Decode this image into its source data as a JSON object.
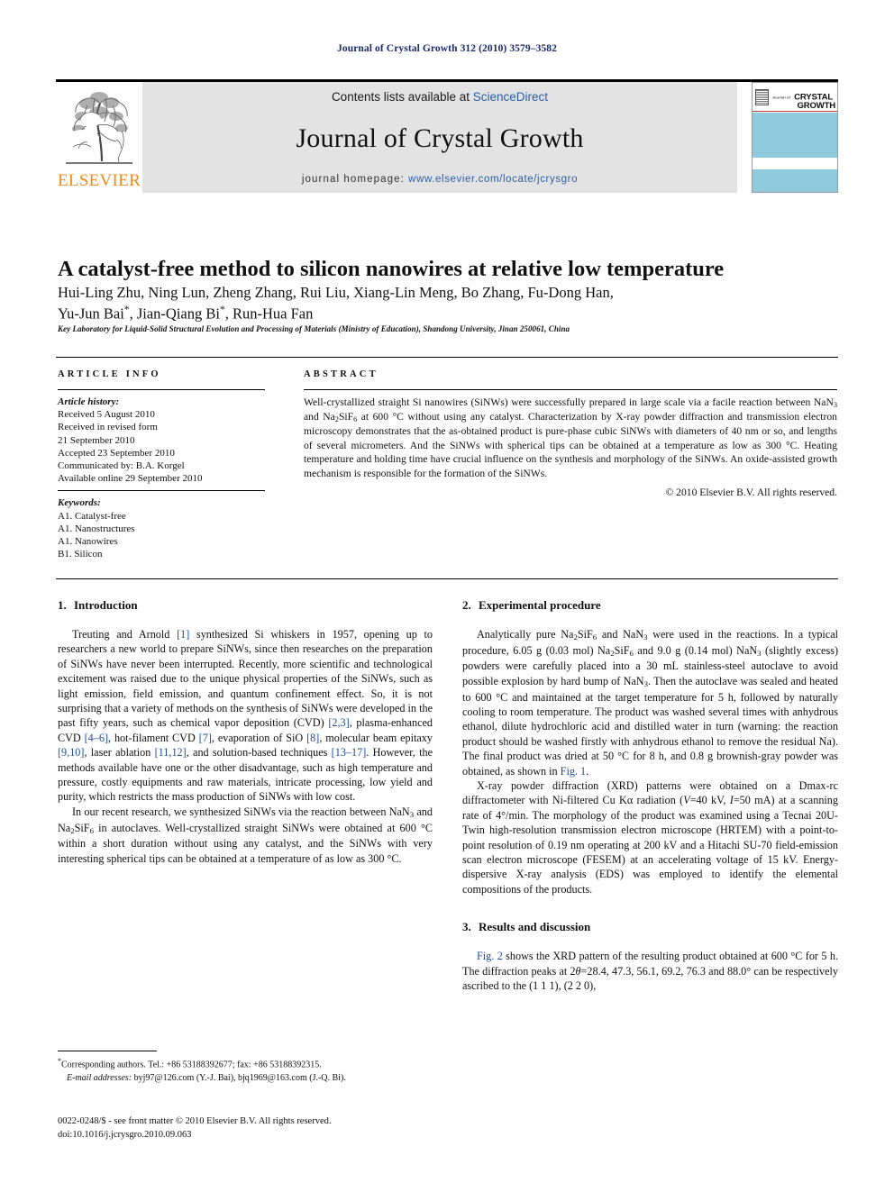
{
  "running_head": "Journal of Crystal Growth 312 (2010) 3579–3582",
  "masthead": {
    "publisher_name": "ELSEVIER",
    "contents_prefix": "Contents lists available at ",
    "contents_link": "ScienceDirect",
    "journal_title": "Journal of Crystal Growth",
    "homepage_label": "journal homepage:",
    "homepage_url": "www.elsevier.com/locate/jcrysgro",
    "cover": {
      "journal_of": "Journal of",
      "line1": "CRYSTAL",
      "line2": "GROWTH"
    },
    "colors": {
      "band_background": "#e3e3e3",
      "link": "#2b5fa8",
      "elsevier_orange": "#f08c1e",
      "cover_photo": "#8ecbdd",
      "cover_rule": "#c0392b"
    }
  },
  "article": {
    "title": "A catalyst-free method to silicon nanowires at relative low temperature",
    "authors_line1": "Hui-Ling Zhu, Ning Lun, Zheng Zhang, Rui Liu, Xiang-Lin Meng, Bo Zhang, Fu-Dong Han,",
    "authors_line2_a": "Yu-Jun Bai",
    "authors_line2_b": ", Jian-Qiang Bi",
    "authors_line2_c": ", Run-Hua Fan",
    "affiliation": "Key Laboratory for Liquid-Solid Structural Evolution and Processing of Materials (Ministry of Education), Shandong University, Jinan 250061, China"
  },
  "article_info": {
    "heading": "ARTICLE INFO",
    "history_label": "Article history:",
    "history": [
      "Received 5 August 2010",
      "Received in revised form",
      "21 September 2010",
      "Accepted 23 September 2010",
      "Communicated by: B.A. Korgel",
      "Available online 29 September 2010"
    ],
    "keywords_label": "Keywords:",
    "keywords": [
      "A1. Catalyst-free",
      "A1. Nanostructures",
      "A1. Nanowires",
      "B1. Silicon"
    ]
  },
  "abstract": {
    "heading": "ABSTRACT",
    "text_part1": "Well-crystallized straight Si nanowires (SiNWs) were successfully prepared in large scale via a facile reaction between NaN",
    "sub1": "3",
    "text_part2": " and Na",
    "sub2": "2",
    "text_part3": "SiF",
    "sub3": "6",
    "text_part4": " at 600 °C without using any catalyst. Characterization by X-ray powder diffraction and transmission electron microscopy demonstrates that the as-obtained product is pure-phase cubic SiNWs with diameters of 40 nm or so, and lengths of several micrometers. And the SiNWs with spherical tips can be obtained at a temperature as low as 300 °C. Heating temperature and holding time have crucial influence on the synthesis and morphology of the SiNWs. An oxide-assisted growth mechanism is responsible for the formation of the SiNWs.",
    "copyright": "© 2010 Elsevier B.V. All rights reserved."
  },
  "sections": {
    "introduction": {
      "number": "1.",
      "title": "Introduction",
      "p1_a": "Treuting and Arnold ",
      "p1_ref1": "[1]",
      "p1_b": " synthesized Si whiskers in 1957, opening up to researchers a new world to prepare SiNWs, since then researches on the preparation of SiNWs have never been interrupted. Recently, more scientific and technological excitement was raised due to the unique physical properties of the SiNWs, such as light emission, field emission, and quantum confinement effect. So, it is not surprising that a variety of methods on the synthesis of SiNWs were developed in the past fifty years, such as chemical vapor deposition (CVD) ",
      "p1_ref2": "[2,3]",
      "p1_c": ", plasma-enhanced CVD ",
      "p1_ref3": "[4–6]",
      "p1_d": ", hot-filament CVD ",
      "p1_ref4": "[7]",
      "p1_e": ", evaporation of SiO ",
      "p1_ref5": "[8]",
      "p1_f": ", molecular beam epitaxy ",
      "p1_ref6": "[9,10]",
      "p1_g": ", laser ablation ",
      "p1_ref7": "[11,12]",
      "p1_h": ", and solution-based techniques ",
      "p1_ref8": "[13–17]",
      "p1_i": ". However, the methods available have one or the other disadvantage, such as high temperature and pressure, costly equipments and raw materials, intricate processing, low yield and purity, which restricts the mass production of SiNWs with low cost.",
      "p2_a": "In our recent research, we synthesized SiNWs via the reaction between NaN",
      "p2_b": " and Na",
      "p2_c": "SiF",
      "p2_d": " in autoclaves. Well-crystallized straight SiNWs were obtained at 600 °C within a short duration without using any catalyst, and the SiNWs with very interesting spherical tips can be obtained at a temperature of as low as 300 °C."
    },
    "experimental": {
      "number": "2.",
      "title": "Experimental procedure",
      "p1_a": "Analytically pure Na",
      "p1_b": "SiF",
      "p1_c": " and NaN",
      "p1_d": " were used in the reactions. In a typical procedure, 6.05 g (0.03 mol) Na",
      "p1_e": "SiF",
      "p1_f": " and 9.0 g (0.14 mol) NaN",
      "p1_g": " (slightly excess) powders were carefully placed into a 30 mL stainless-steel autoclave to avoid possible explosion by hard bump of NaN",
      "p1_h": ". Then the autoclave was sealed and heated to 600 °C and maintained at the target temperature for 5 h, followed by naturally cooling to room temperature. The product was washed several times with anhydrous ethanol, dilute hydrochloric acid and distilled water in turn (warning: the reaction product should be washed firstly with anhydrous ethanol to remove the residual Na). The final product was dried at 50 °C for 8 h, and 0.8 g brownish-gray powder was obtained, as shown in ",
      "p1_figref": "Fig. 1",
      "p1_i": ".",
      "p2_a": "X-ray powder diffraction (XRD) patterns were obtained on a Dmax-rc diffractometer with Ni-filtered Cu K",
      "p2_alpha": "α",
      "p2_b": " radiation (",
      "p2_V": "V",
      "p2_c": "=40 kV, ",
      "p2_I": "I",
      "p2_d": "=50 mA) at a scanning rate of 4°/min. The morphology of the product was examined using a Tecnai 20U-Twin high-resolution transmission electron microscope (HRTEM) with a point-to-point resolution of 0.19 nm operating at 200 kV and a Hitachi SU-70 field-emission scan electron microscope (FESEM) at an accelerating voltage of 15 kV. Energy-dispersive X-ray analysis (EDS) was employed to identify the elemental compositions of the products."
    },
    "results": {
      "number": "3.",
      "title": "Results and discussion",
      "p1_figref": "Fig. 2",
      "p1_a": " shows the XRD pattern of the resulting product obtained at 600 °C for 5 h. The diffraction peaks at 2",
      "p1_theta": "θ",
      "p1_b": "=28.4, 47.3, 56.1, 69.2, 76.3 and 88.0° can be respectively ascribed to the (1 1 1), (2 2 0),"
    }
  },
  "footnote": {
    "corresponding": "Corresponding authors. Tel.: +86 53188392677; fax: +86 53188392315.",
    "email_label": "E-mail addresses:",
    "emails": " byj97@126.com (Y.-J. Bai), bjq1969@163.com (J.-Q. Bi)."
  },
  "footer": {
    "issn_line": "0022-0248/$ - see front matter © 2010 Elsevier B.V. All rights reserved.",
    "doi_line": "doi:10.1016/j.jcrysgro.2010.09.063"
  }
}
